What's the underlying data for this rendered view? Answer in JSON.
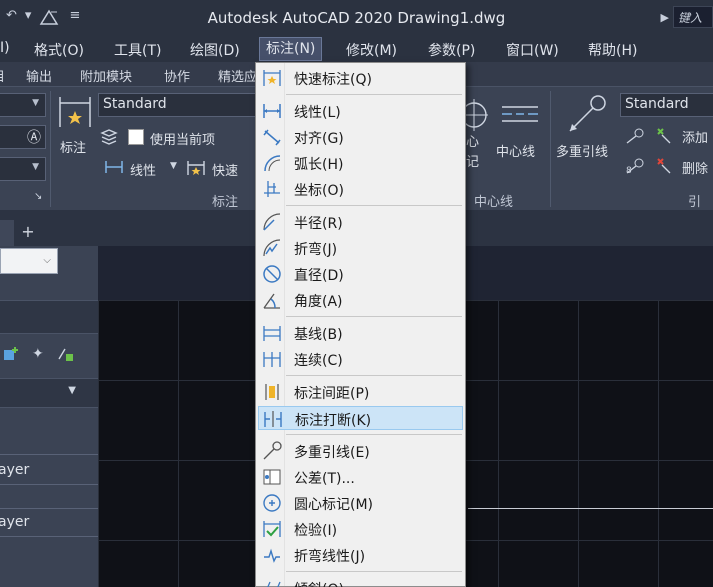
{
  "window": {
    "title": "Autodesk AutoCAD 2020    Drawing1.dwg",
    "search_placeholder": "键入"
  },
  "menubar": {
    "items": [
      "I)",
      "格式(O)",
      "工具(T)",
      "绘图(D)",
      "标注(N)",
      "修改(M)",
      "参数(P)",
      "窗口(W)",
      "帮助(H)"
    ]
  },
  "ribbon_tabs": [
    "目",
    "输出",
    "附加模块",
    "协作",
    "精选应"
  ],
  "ribbon": {
    "style_combo": "Standard",
    "layer_checkbox_label": "使用当前项",
    "big_button_label": "标注",
    "linear_label": "线性",
    "quick_label": "快速",
    "panel_dimension": "标注",
    "center_mark_label": "心\n记",
    "centerline_label": "中心线",
    "panel_centerline": "中心线",
    "multileader_label": "多重引线",
    "ml_style_combo": "Standard",
    "add_label": "添加",
    "remove_label": "删除",
    "panel_leader": "引线"
  },
  "palette": {
    "layer_1": "ayer",
    "layer_2": "ayer"
  },
  "dropdown": {
    "items": [
      {
        "label": "快速标注(Q)",
        "icon": "quick-dim-icon"
      },
      {
        "label": "线性(L)",
        "icon": "linear-icon"
      },
      {
        "label": "对齐(G)",
        "icon": "aligned-icon"
      },
      {
        "label": "弧长(H)",
        "icon": "arc-length-icon"
      },
      {
        "label": "坐标(O)",
        "icon": "ordinate-icon"
      },
      {
        "label": "半径(R)",
        "icon": "radius-icon"
      },
      {
        "label": "折弯(J)",
        "icon": "jogged-icon"
      },
      {
        "label": "直径(D)",
        "icon": "diameter-icon"
      },
      {
        "label": "角度(A)",
        "icon": "angular-icon"
      },
      {
        "label": "基线(B)",
        "icon": "baseline-icon"
      },
      {
        "label": "连续(C)",
        "icon": "continue-icon"
      },
      {
        "label": "标注间距(P)",
        "icon": "dim-space-icon"
      },
      {
        "label": "标注打断(K)",
        "icon": "dim-break-icon"
      },
      {
        "label": "多重引线(E)",
        "icon": "multileader-icon"
      },
      {
        "label": "公差(T)...",
        "icon": "tolerance-icon"
      },
      {
        "label": "圆心标记(M)",
        "icon": "center-mark-icon"
      },
      {
        "label": "检验(I)",
        "icon": "inspection-icon"
      },
      {
        "label": "折弯线性(J)",
        "icon": "jogged-linear-icon"
      },
      {
        "label": "倾斜(Q)",
        "icon": "oblique-icon"
      }
    ],
    "highlighted_index": 12
  }
}
